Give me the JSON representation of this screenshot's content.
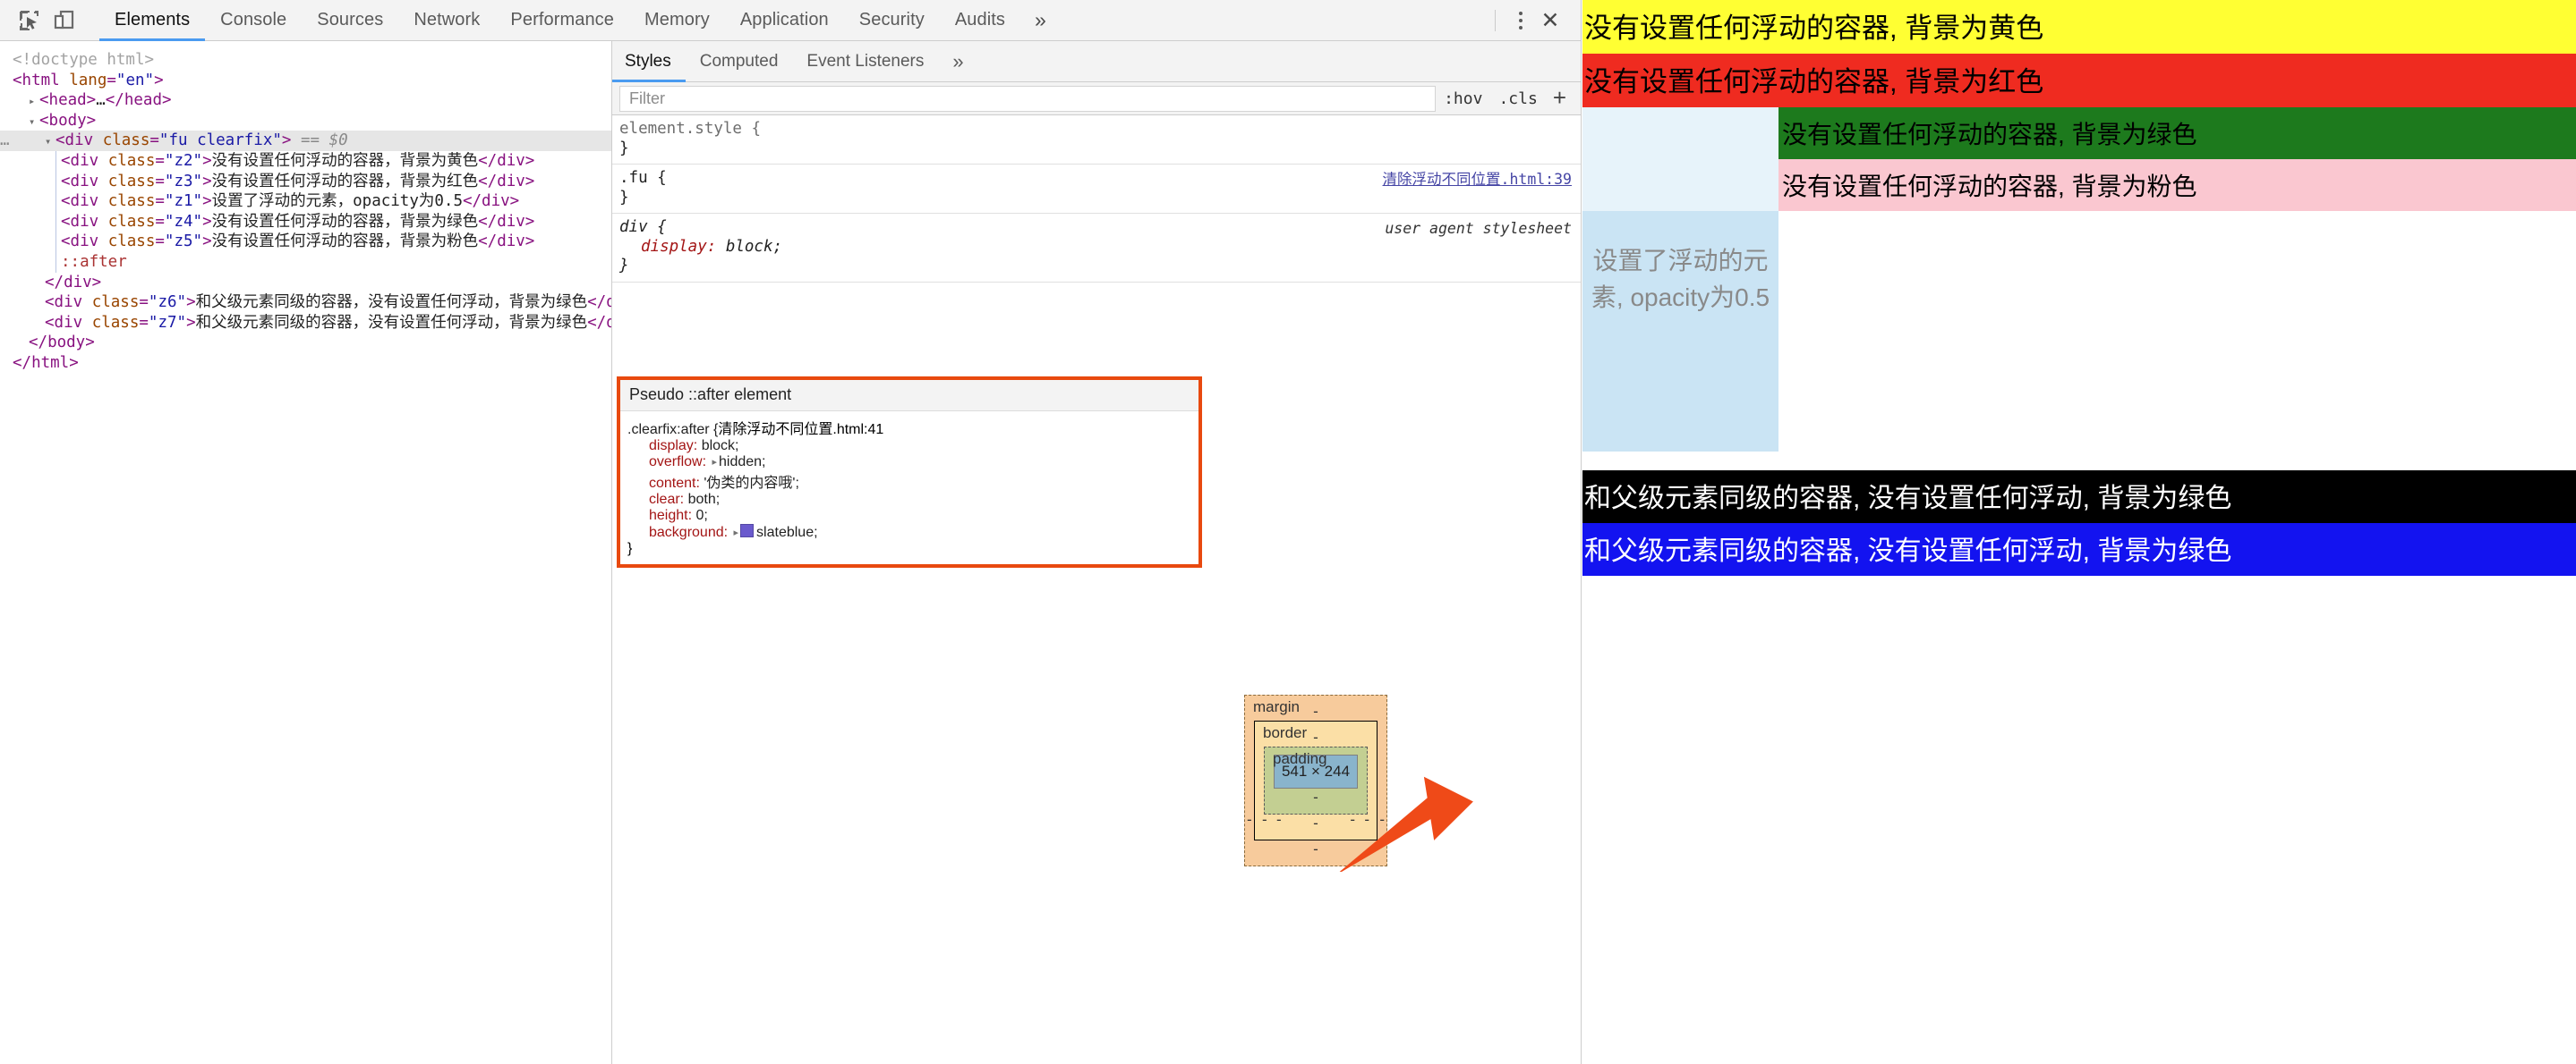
{
  "devtools": {
    "toolbar": {
      "inspect_icon": "inspect-element-icon",
      "device_icon": "device-toolbar-icon",
      "tabs": [
        {
          "label": "Elements",
          "active": true
        },
        {
          "label": "Console",
          "active": false
        },
        {
          "label": "Sources",
          "active": false
        },
        {
          "label": "Network",
          "active": false
        },
        {
          "label": "Performance",
          "active": false
        },
        {
          "label": "Memory",
          "active": false
        },
        {
          "label": "Application",
          "active": false
        },
        {
          "label": "Security",
          "active": false
        },
        {
          "label": "Audits",
          "active": false
        }
      ],
      "more_tabs": "»",
      "menu_icon": "kebab-menu-icon",
      "close_label": "✕"
    },
    "dom_tree": {
      "lines": [
        {
          "indent": 0,
          "html": "<span class=\"cmt\">&lt;!doctype html&gt;</span>"
        },
        {
          "indent": 0,
          "html": "<span class=\"tw\">&lt;html </span><span class=\"an\">lang</span><span class=\"tw\">=</span><span class=\"av\">\"en\"</span><span class=\"tw\">&gt;</span>"
        },
        {
          "indent": 1,
          "html": "<span class=\"arrow\">▸</span><span class=\"tw\">&lt;head&gt;</span><span class=\"txt\">…</span><span class=\"tw\">&lt;/head&gt;</span>"
        },
        {
          "indent": 1,
          "html": "<span class=\"arrow\">▾</span><span class=\"tw\">&lt;body&gt;</span>"
        },
        {
          "indent": 2,
          "selected": true,
          "html": "<span class=\"arrow\">▾</span><span class=\"tw\">&lt;div </span><span class=\"an\">class</span><span class=\"tw\">=</span><span class=\"av\">\"fu clearfix\"</span><span class=\"tw\">&gt;</span> <span class=\"dollar\">== $0</span>"
        },
        {
          "indent": 3,
          "html": "<span class=\"tw\">&lt;div </span><span class=\"an\">class</span><span class=\"tw\">=</span><span class=\"av\">\"z2\"</span><span class=\"tw\">&gt;</span><span class=\"txt\">没有设置任何浮动的容器，背景为黄色</span><span class=\"tw\">&lt;/div&gt;</span>"
        },
        {
          "indent": 3,
          "html": "<span class=\"tw\">&lt;div </span><span class=\"an\">class</span><span class=\"tw\">=</span><span class=\"av\">\"z3\"</span><span class=\"tw\">&gt;</span><span class=\"txt\">没有设置任何浮动的容器，背景为红色</span><span class=\"tw\">&lt;/div&gt;</span>"
        },
        {
          "indent": 3,
          "html": "<span class=\"tw\">&lt;div </span><span class=\"an\">class</span><span class=\"tw\">=</span><span class=\"av\">\"z1\"</span><span class=\"tw\">&gt;</span><span class=\"txt\">设置了浮动的元素，opacity为0.5</span><span class=\"tw\">&lt;/div&gt;</span>"
        },
        {
          "indent": 3,
          "html": "<span class=\"tw\">&lt;div </span><span class=\"an\">class</span><span class=\"tw\">=</span><span class=\"av\">\"z4\"</span><span class=\"tw\">&gt;</span><span class=\"txt\">没有设置任何浮动的容器，背景为绿色</span><span class=\"tw\">&lt;/div&gt;</span>"
        },
        {
          "indent": 3,
          "html": "<span class=\"tw\">&lt;div </span><span class=\"an\">class</span><span class=\"tw\">=</span><span class=\"av\">\"z5\"</span><span class=\"tw\">&gt;</span><span class=\"txt\">没有设置任何浮动的容器，背景为粉色</span><span class=\"tw\">&lt;/div&gt;</span>"
        },
        {
          "indent": 3,
          "html": "<span class=\"pseudo\">::after</span>"
        },
        {
          "indent": 2,
          "html": "<span class=\"tw\">&lt;/div&gt;</span>"
        },
        {
          "indent": 2,
          "html": "<span class=\"tw\">&lt;div </span><span class=\"an\">class</span><span class=\"tw\">=</span><span class=\"av\">\"z6\"</span><span class=\"tw\">&gt;</span><span class=\"txt\">和父级元素同级的容器，没有设置任何浮动，背景为绿色</span><span class=\"tw\">&lt;/div&gt;</span>"
        },
        {
          "indent": 2,
          "html": "<span class=\"tw\">&lt;div </span><span class=\"an\">class</span><span class=\"tw\">=</span><span class=\"av\">\"z7\"</span><span class=\"tw\">&gt;</span><span class=\"txt\">和父级元素同级的容器，没有设置任何浮动，背景为绿色</span><span class=\"tw\">&lt;/div&gt;</span>"
        },
        {
          "indent": 1,
          "html": "<span class=\"tw\">&lt;/body&gt;</span>"
        },
        {
          "indent": 0,
          "html": "<span class=\"tw\">&lt;/html&gt;</span>"
        }
      ],
      "selected_marker": "…"
    },
    "styles": {
      "tabs": [
        {
          "label": "Styles",
          "active": true
        },
        {
          "label": "Computed",
          "active": false
        },
        {
          "label": "Event Listeners",
          "active": false
        }
      ],
      "more_tabs": "»",
      "filter_placeholder": "Filter",
      "hov_button": ":hov",
      "cls_button": ".cls",
      "add_button": "+",
      "rules": [
        {
          "selector": "element.style",
          "source": "",
          "source_kind": "none",
          "declarations": []
        },
        {
          "selector": ".fu",
          "source": "清除浮动不同位置.html:39",
          "source_kind": "link",
          "declarations": []
        },
        {
          "selector": "div",
          "source": "user agent stylesheet",
          "source_kind": "ua",
          "declarations": [
            {
              "name": "display",
              "value": "block",
              "expandable": false
            }
          ]
        }
      ],
      "pseudo_block": {
        "header": "Pseudo ::after element",
        "selector": ".clearfix:after",
        "source": "清除浮动不同位置.html:41",
        "declarations": [
          {
            "name": "display",
            "value": "block",
            "expandable": false
          },
          {
            "name": "overflow",
            "value": "hidden",
            "expandable": true
          },
          {
            "name": "content",
            "value": "'伪类的内容哦'",
            "expandable": false
          },
          {
            "name": "clear",
            "value": "both",
            "expandable": false
          },
          {
            "name": "height",
            "value": "0",
            "expandable": false
          },
          {
            "name": "background",
            "value": "slateblue",
            "expandable": true,
            "swatch": "#6a5acd"
          }
        ],
        "highlight_color": "#e8490f"
      },
      "box_model": {
        "margin_label": "margin",
        "border_label": "border",
        "padding_label": "padding",
        "content_size": "541 × 244",
        "dash": "-"
      }
    }
  },
  "preview": {
    "blocks": [
      {
        "name": "z2",
        "text": "没有设置任何浮动的容器, 背景为黄色",
        "bg": "#ffff33",
        "fg": "#000000"
      },
      {
        "name": "z3",
        "text": "没有设置任何浮动的容器, 背景为红色",
        "bg": "#ef2b20",
        "fg": "#000000"
      },
      {
        "name": "z1",
        "text": "设置了浮动的元素, opacity为0.5",
        "bg": "#cae4f4",
        "fg": "#898989"
      },
      {
        "name": "z4",
        "text": "没有设置任何浮动的容器, 背景为绿色",
        "bg": "#1d7a1d",
        "fg": "#000000"
      },
      {
        "name": "z5",
        "text": "没有设置任何浮动的容器, 背景为粉色",
        "bg": "#fac7d0",
        "fg": "#000000"
      },
      {
        "name": "z6",
        "text": "和父级元素同级的容器, 没有设置任何浮动, 背景为绿色",
        "bg": "#000000",
        "fg": "#ffffff"
      },
      {
        "name": "z7",
        "text": "和父级元素同级的容器, 没有设置任何浮动, 背景为绿色",
        "bg": "#1313f0",
        "fg": "#ffffff"
      }
    ]
  }
}
